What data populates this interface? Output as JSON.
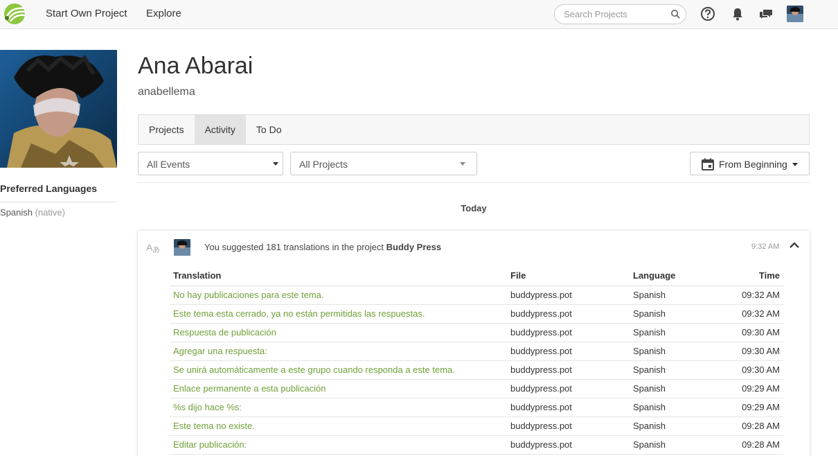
{
  "nav": {
    "start_project": "Start Own Project",
    "explore": "Explore",
    "search_placeholder": "Search Projects"
  },
  "profile": {
    "name": "Ana Abarai",
    "username": "anabellema",
    "preferred_languages_title": "Preferred Languages",
    "language": "Spanish",
    "language_note": "(native)"
  },
  "tabs": [
    {
      "label": "Projects",
      "active": false
    },
    {
      "label": "Activity",
      "active": true
    },
    {
      "label": "To Do",
      "active": false
    }
  ],
  "filters": {
    "events": "All Events",
    "projects": "All Projects",
    "date": "From Beginning"
  },
  "activity": {
    "day": "Today",
    "summary_prefix": "You suggested 181 translations in the project",
    "project": "Buddy Press",
    "time": "9:32 AM",
    "columns": {
      "translation": "Translation",
      "file": "File",
      "language": "Language",
      "time": "Time"
    },
    "rows": [
      {
        "translation": "No hay publicaciones para este tema.",
        "file": "buddypress.pot",
        "language": "Spanish",
        "time": "09:32 AM"
      },
      {
        "translation": "Este tema esta cerrado, ya no están permitidas las respuestas.",
        "file": "buddypress.pot",
        "language": "Spanish",
        "time": "09:32 AM"
      },
      {
        "translation": "Respuesta de publicación",
        "file": "buddypress.pot",
        "language": "Spanish",
        "time": "09:30 AM"
      },
      {
        "translation": "Agregar una respuesta:",
        "file": "buddypress.pot",
        "language": "Spanish",
        "time": "09:30 AM"
      },
      {
        "translation": "Se unirá automáticamente a este grupo cuando responda a este tema.",
        "file": "buddypress.pot",
        "language": "Spanish",
        "time": "09:30 AM"
      },
      {
        "translation": "Enlace permanente a esta publicación",
        "file": "buddypress.pot",
        "language": "Spanish",
        "time": "09:29 AM"
      },
      {
        "translation": "%s dijo hace %s:",
        "file": "buddypress.pot",
        "language": "Spanish",
        "time": "09:29 AM"
      },
      {
        "translation": "Este tema no existe.",
        "file": "buddypress.pot",
        "language": "Spanish",
        "time": "09:28 AM"
      },
      {
        "translation": "Editar publicación:",
        "file": "buddypress.pot",
        "language": "Spanish",
        "time": "09:28 AM"
      }
    ]
  },
  "icons": {
    "logo": "logo-icon",
    "search": "search-icon",
    "help": "help-icon",
    "notifications": "bell-icon",
    "messages": "chat-icon",
    "calendar": "calendar-icon",
    "translate": "translate-icon",
    "collapse": "chevron-up-icon"
  },
  "colors": {
    "accent_green": "#6fa038",
    "logo_green": "#8dc63f",
    "topbar": "#f8f8f8",
    "active_tab": "#e3e3e3"
  }
}
